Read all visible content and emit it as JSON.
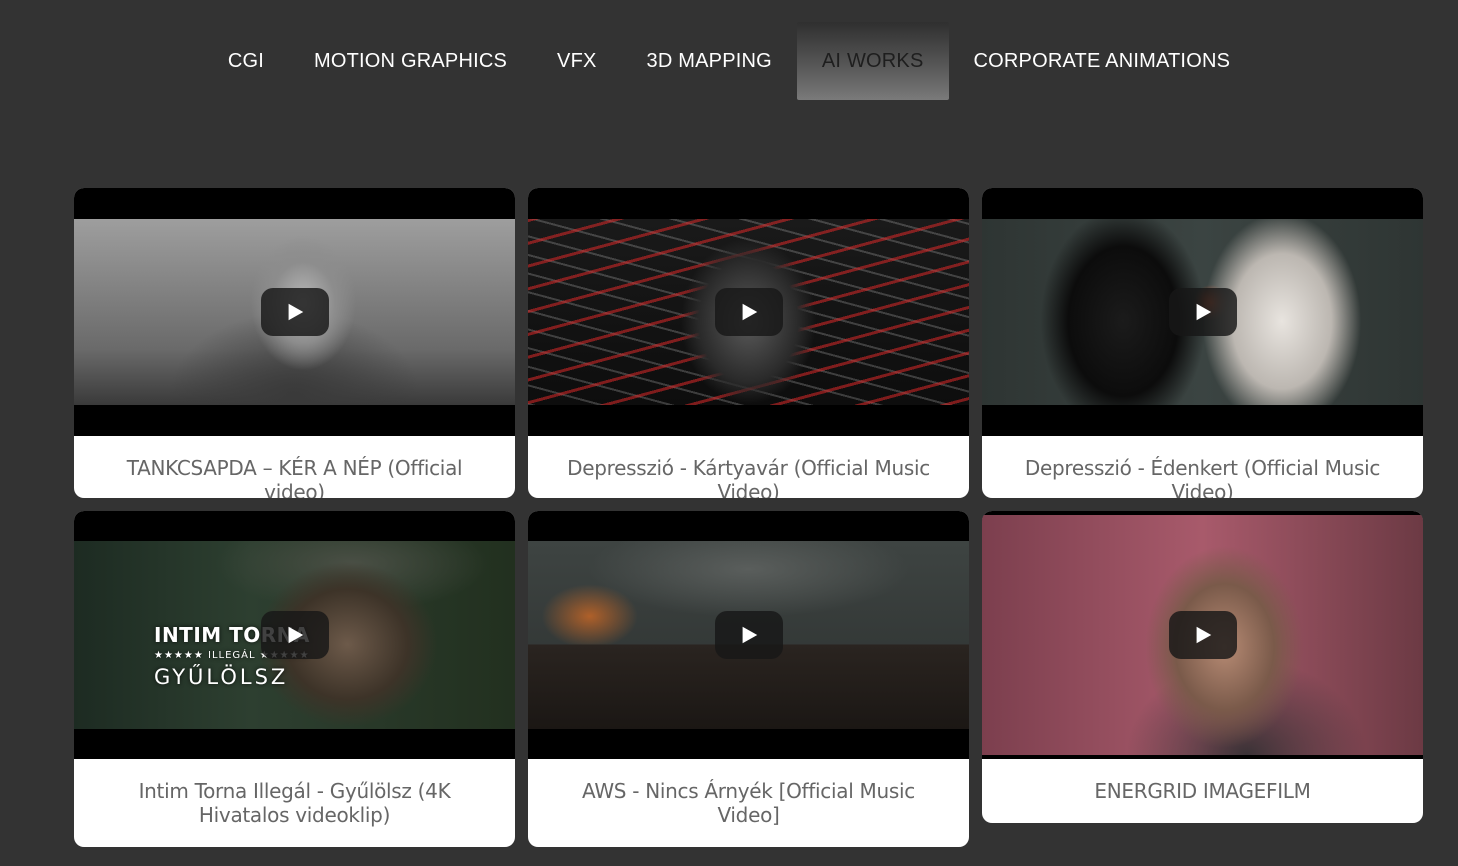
{
  "nav": {
    "tabs": [
      {
        "label": "CGI",
        "active": false
      },
      {
        "label": "MOTION GRAPHICS",
        "active": false
      },
      {
        "label": "VFX",
        "active": false
      },
      {
        "label": "3D MAPPING",
        "active": false
      },
      {
        "label": "AI WORKS",
        "active": true
      },
      {
        "label": "CORPORATE ANIMATIONS",
        "active": false
      }
    ]
  },
  "videos": [
    {
      "title": "TANKCSAPDA – KÉR A NÉP (Official video)",
      "icon": "play-icon"
    },
    {
      "title": "Depresszió - Kártyavár (Official Music Video)",
      "icon": "play-icon"
    },
    {
      "title": "Depresszió - Édenkert (Official Music Video)",
      "icon": "play-icon"
    },
    {
      "title": "Intim Torna Illegál - Gyűlölsz (4K Hivatalos videoklip)",
      "icon": "play-icon",
      "thumbnail_text": {
        "line1": "INTIM TORNA",
        "line2": "★★★★★ ILLEGÁL ★★★★★",
        "line3": "GYŰLÖLSZ"
      }
    },
    {
      "title": "AWS - Nincs Árnyék [Official Music Video]",
      "icon": "play-icon"
    },
    {
      "title": "ENERGRID IMAGEFILM",
      "icon": "play-icon"
    }
  ],
  "colors": {
    "background": "#333333",
    "caption_text": "#666666",
    "nav_text": "#ffffff",
    "active_tab_text": "#1e1e1e"
  }
}
